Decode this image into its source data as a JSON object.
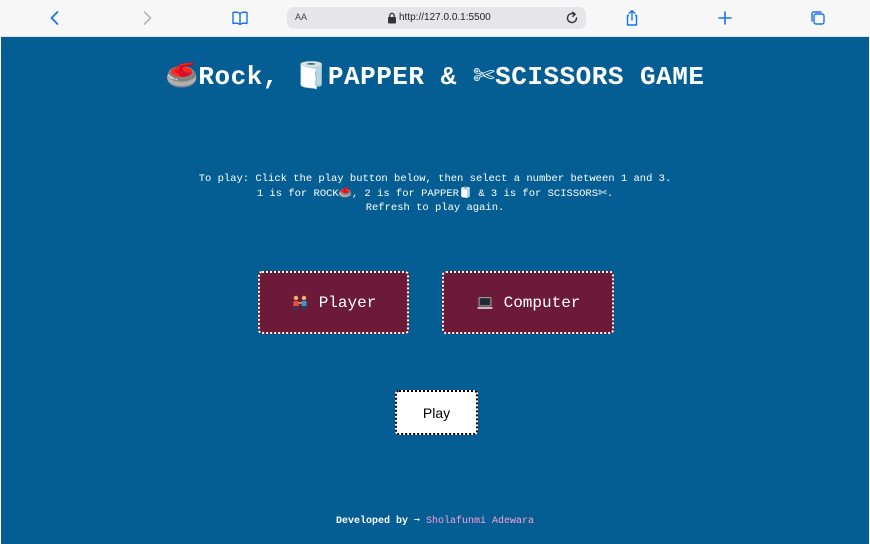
{
  "browser": {
    "text_size_label": "AA",
    "url": "http://127.0.0.1:5500",
    "icons": {
      "back": "chevron-left-icon",
      "forward": "chevron-right-icon",
      "bookmarks": "book-icon",
      "lock": "lock-icon",
      "reload": "reload-icon",
      "share": "share-icon",
      "new_tab": "plus-icon",
      "tabs": "tabs-icon"
    },
    "accent_color": "#1a73e8"
  },
  "page": {
    "background": "#045e93",
    "title": {
      "rock_emoji": "🥌",
      "rock": "Rock, ",
      "paper_emoji": "🧻",
      "paper": "PAPPER & ",
      "scissors_emoji": "✄",
      "scissors": "SCISSORS GAME"
    },
    "instructions": {
      "line1": "To play: Click the play button below, then select a number between 1 and 3.",
      "line2_a": "1 is for ROCK",
      "line2_rock_emoji": "🥌",
      "line2_b": ", 2 is for PAPPER",
      "line2_paper_emoji": "🧻",
      "line2_c": " & 3 is for SCISSORS",
      "line2_scissors_emoji": "✄",
      "line2_d": ".",
      "line3": "Refresh to play again."
    },
    "player_card": {
      "icon": "people-holding-hands-icon",
      "label": "Player"
    },
    "computer_card": {
      "icon": "laptop-icon",
      "label": "Computer"
    },
    "play_button": {
      "label": "Play"
    },
    "footer": {
      "prefix": "Developed by ",
      "arrow": "➞ ",
      "author": "Sholafunmi Adewara"
    },
    "colors": {
      "card": "#6b1b38",
      "link": "#ff9fd8"
    }
  }
}
